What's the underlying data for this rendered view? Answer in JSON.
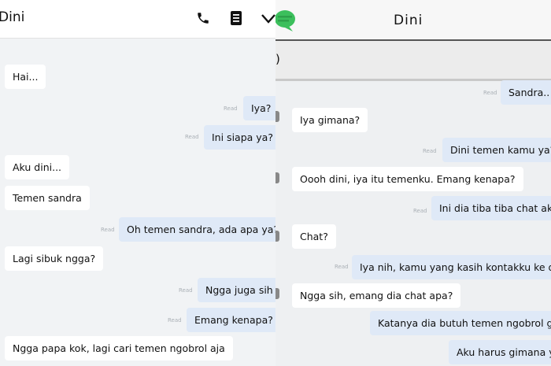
{
  "left": {
    "contact": "Dini",
    "read_label": "Read",
    "messages": [
      {
        "dir": "in",
        "text": "Hai..."
      },
      {
        "dir": "out",
        "text": "Iya?"
      },
      {
        "dir": "out",
        "text": "Ini siapa ya?"
      },
      {
        "dir": "in",
        "text": "Aku dini..."
      },
      {
        "dir": "in",
        "text": "Temen sandra"
      },
      {
        "dir": "out",
        "text": "Oh temen sandra, ada apa ya?"
      },
      {
        "dir": "in",
        "text": "Lagi sibuk ngga?"
      },
      {
        "dir": "out",
        "text": "Ngga juga sih"
      },
      {
        "dir": "out",
        "text": "Emang kenapa?"
      },
      {
        "dir": "in",
        "text": "Ngga papa kok, lagi cari temen ngobrol aja"
      }
    ]
  },
  "right": {
    "contact": "Dini",
    "partial_text": ")",
    "read_label": "Read",
    "messages": [
      {
        "dir": "out",
        "text": "Sandra.."
      },
      {
        "dir": "in",
        "text": "Iya gimana?"
      },
      {
        "dir": "out",
        "text": "Dini temen kamu ya?"
      },
      {
        "dir": "in",
        "text": "Oooh dini, iya itu temenku. Emang kenapa?"
      },
      {
        "dir": "out",
        "text": "Ini dia tiba tiba chat aku"
      },
      {
        "dir": "in",
        "text": "Chat?"
      },
      {
        "dir": "out",
        "text": "Iya nih, kamu yang kasih kontakku ke dia?"
      },
      {
        "dir": "in",
        "text": "Ngga sih, emang dia chat apa?"
      },
      {
        "dir": "out",
        "text": "Katanya dia butuh temen ngobrol gitu"
      },
      {
        "dir": "out",
        "text": "Aku harus gimana ya?"
      }
    ]
  }
}
